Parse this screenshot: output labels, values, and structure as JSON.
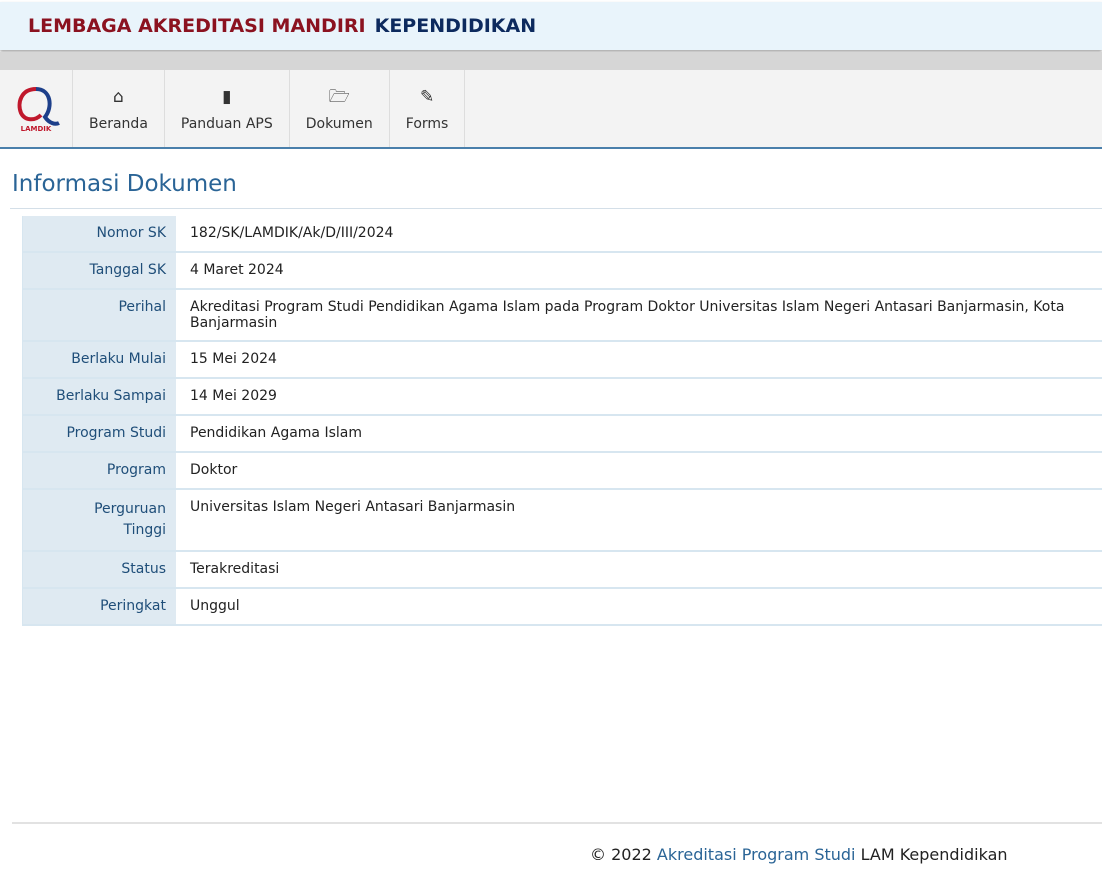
{
  "header": {
    "title_part1": "LEMBAGA AKREDITASI MANDIRI",
    "title_part2": "KEPENDIDIKAN"
  },
  "logo": {
    "text": "LAMDIK"
  },
  "nav": [
    {
      "label": "Beranda",
      "icon": "home-icon"
    },
    {
      "label": "Panduan APS",
      "icon": "book-icon"
    },
    {
      "label": "Dokumen",
      "icon": "folder-open-icon"
    },
    {
      "label": "Forms",
      "icon": "edit-icon"
    }
  ],
  "page_title": "Informasi Dokumen",
  "rows": [
    {
      "label": "Nomor SK",
      "value": "182/SK/LAMDIK/Ak/D/III/2024"
    },
    {
      "label": "Tanggal SK",
      "value": "4 Maret 2024"
    },
    {
      "label": "Perihal",
      "value": "Akreditasi Program Studi Pendidikan Agama Islam pada Program Doktor Universitas Islam Negeri Antasari Banjarmasin, Kota Banjarmasin"
    },
    {
      "label": "Berlaku Mulai",
      "value": "15 Mei 2024"
    },
    {
      "label": "Berlaku Sampai",
      "value": "14 Mei 2029"
    },
    {
      "label": "Program Studi",
      "value": "Pendidikan Agama Islam"
    },
    {
      "label": "Program",
      "value": "Doktor"
    },
    {
      "label": "Perguruan Tinggi",
      "value": "Universitas Islam Negeri Antasari Banjarmasin"
    },
    {
      "label": "Status",
      "value": "Terakreditasi"
    },
    {
      "label": "Peringkat",
      "value": "Unggul"
    }
  ],
  "footer": {
    "copyright": "© 2022",
    "link": "Akreditasi Program Studi",
    "suffix": "LAM Kependidikan"
  }
}
